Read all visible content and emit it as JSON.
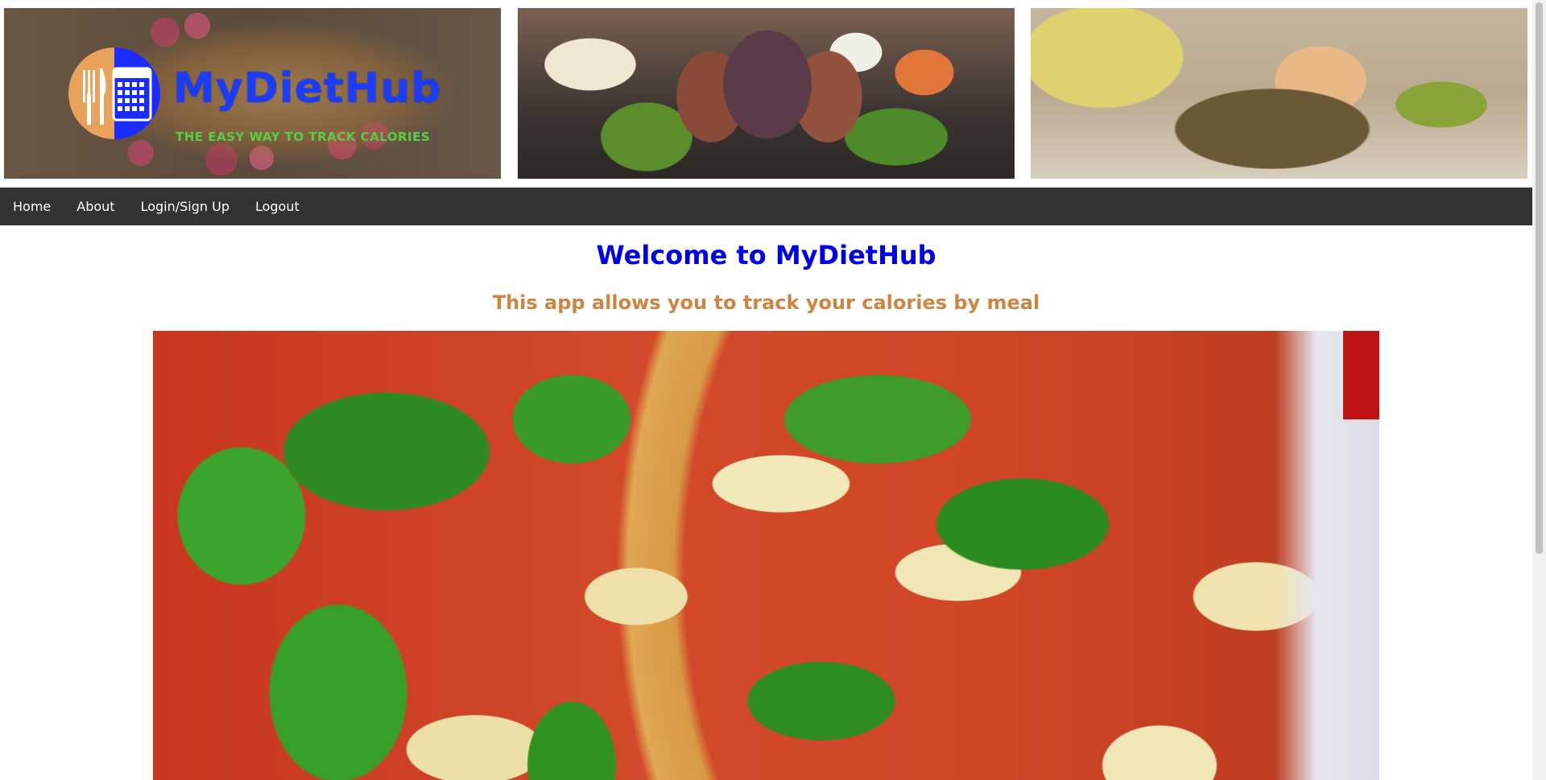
{
  "banner": {
    "logo_title": "MyDietHub",
    "logo_tagline": "THE EASY WAY TO TRACK CALORIES",
    "images": [
      "pancakes-with-raspberries",
      "figs-cheese-salad",
      "grilled-fish-with-shrimp"
    ]
  },
  "nav": {
    "items": [
      {
        "label": "Home"
      },
      {
        "label": "About"
      },
      {
        "label": "Login/Sign Up"
      },
      {
        "label": "Logout"
      }
    ]
  },
  "main": {
    "title": "Welcome to MyDietHub",
    "subtitle": "This app allows you to track your calories by meal",
    "hero_image": "margherita-pizza-with-basil"
  },
  "colors": {
    "title": "#0000e6",
    "subtitle": "#cd853f",
    "nav_bg": "#333333",
    "logo_blue": "#1a3cff",
    "logo_green": "#52d141"
  }
}
